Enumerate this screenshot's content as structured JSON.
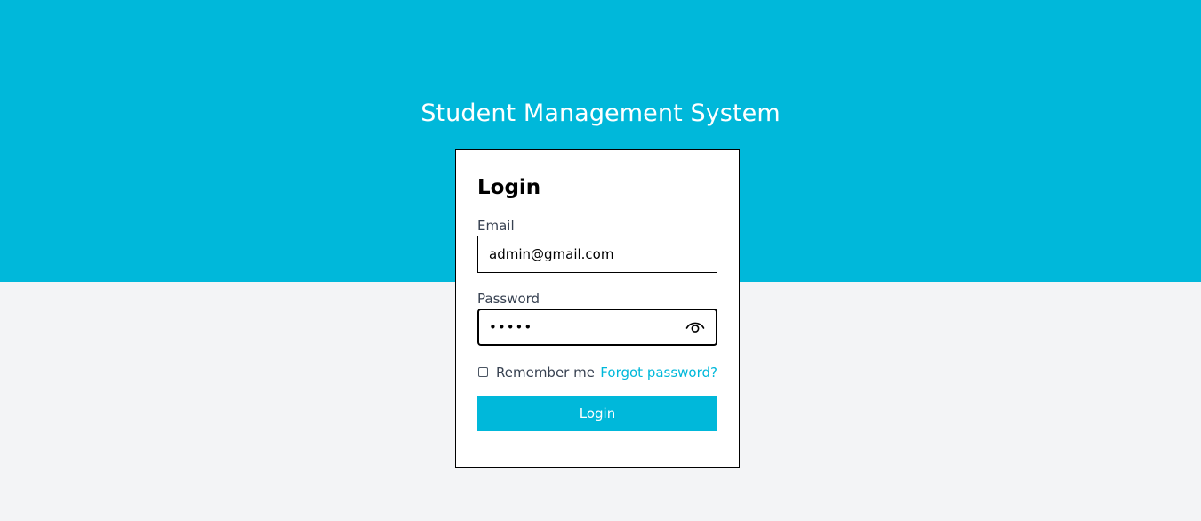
{
  "app": {
    "title": "Student Management System"
  },
  "login_form": {
    "heading": "Login",
    "email": {
      "label": "Email",
      "value": "admin@gmail.com"
    },
    "password": {
      "label": "Password",
      "value": "•••••",
      "toggle_icon": "eye-icon"
    },
    "remember_me": {
      "label": "Remember me",
      "checked": false
    },
    "forgot_password_label": "Forgot password?",
    "submit_label": "Login"
  },
  "colors": {
    "accent": "#00b8da",
    "page_background": "#f3f4f6",
    "card_background": "#ffffff"
  }
}
